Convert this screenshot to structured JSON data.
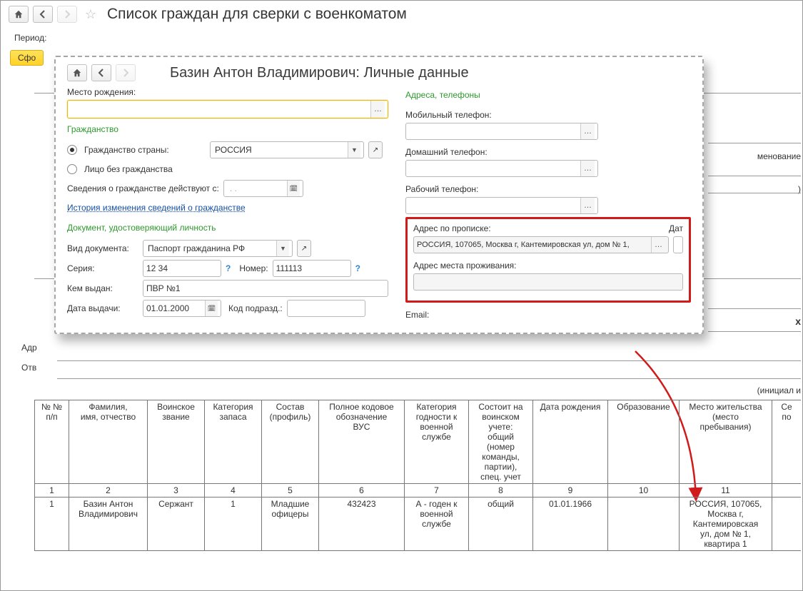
{
  "header": {
    "title": "Список граждан для сверки с военкоматом"
  },
  "period": {
    "label": "Период:",
    "form_btn": "Сфо"
  },
  "dialog": {
    "title": "Базин Антон Владимирович: Личные данные",
    "birthplace_label": "Место рождения:",
    "citizenship_section": "Гражданство",
    "radio_country": "Гражданство страны:",
    "country_value": "РОССИЯ",
    "radio_stateless": "Лицо без гражданства",
    "citizenship_date_label": "Сведения о гражданстве действуют с:",
    "citizenship_date_value": ".   .",
    "history_link": "История изменения сведений о гражданстве",
    "identity_section": "Документ, удостоверяющий личность",
    "doc_type_label": "Вид документа:",
    "doc_type_value": "Паспорт гражданина РФ",
    "series_label": "Серия:",
    "series_value": "12 34",
    "number_label": "Номер:",
    "number_value": "111113",
    "issued_by_label": "Кем выдан:",
    "issued_by_value": "ПВР №1",
    "issue_date_label": "Дата выдачи:",
    "issue_date_value": "01.01.2000",
    "subdiv_label": "Код подразд.:",
    "addresses_section": "Адреса, телефоны",
    "mobile_label": "Мобильный телефон:",
    "home_label": "Домашний телефон:",
    "work_label": "Рабочий телефон:",
    "reg_addr_label": "Адрес по прописке:",
    "reg_addr_value": "РОССИЯ, 107065, Москва г, Кантемировская ул, дом № 1,",
    "date_frag": "Дат",
    "res_addr_label": "Адрес места проживания:",
    "email_label": "Email:"
  },
  "side_labels": {
    "addr": "Адр",
    "otv": "Отв"
  },
  "right_fragments": {
    "menovanie": "менование",
    "paren": ")",
    "x": "x",
    "initals": "(инициал и"
  },
  "table": {
    "headers": {
      "num": "№ №\nп/п",
      "fio": "Фамилия,\nимя, отчество",
      "rank": "Воинское\nзвание",
      "reserve_cat": "Категория\nзапаса",
      "composition": "Состав\n(профиль)",
      "vus": "Полное кодовое\nобозначение\nВУС",
      "fitness": "Категория\nгодности к\nвоенной\nслужбе",
      "registration": "Состоит на\nвоинском\nучете:\nобщий\n(номер\nкоманды,\nпартии),\nспец. учет",
      "dob": "Дата рождения",
      "education": "Образование",
      "residence": "Место жительства\n(место\nпребывания)",
      "se_frag": "Се\nпо"
    },
    "index_row": [
      "1",
      "2",
      "3",
      "4",
      "5",
      "6",
      "7",
      "8",
      "9",
      "10",
      "11"
    ],
    "data_row": {
      "num": "1",
      "fio": "Базин Антон\nВладимирович",
      "rank": "Сержант",
      "reserve_cat": "1",
      "composition": "Младшие\nофицеры",
      "vus": "432423",
      "fitness": "А - годен к\nвоенной\nслужбе",
      "registration": "общий",
      "dob": "01.01.1966",
      "education": "",
      "residence": "РОССИЯ, 107065,\nМосква г,\nКантемировская\nул, дом № 1,\nквартира 1"
    }
  }
}
